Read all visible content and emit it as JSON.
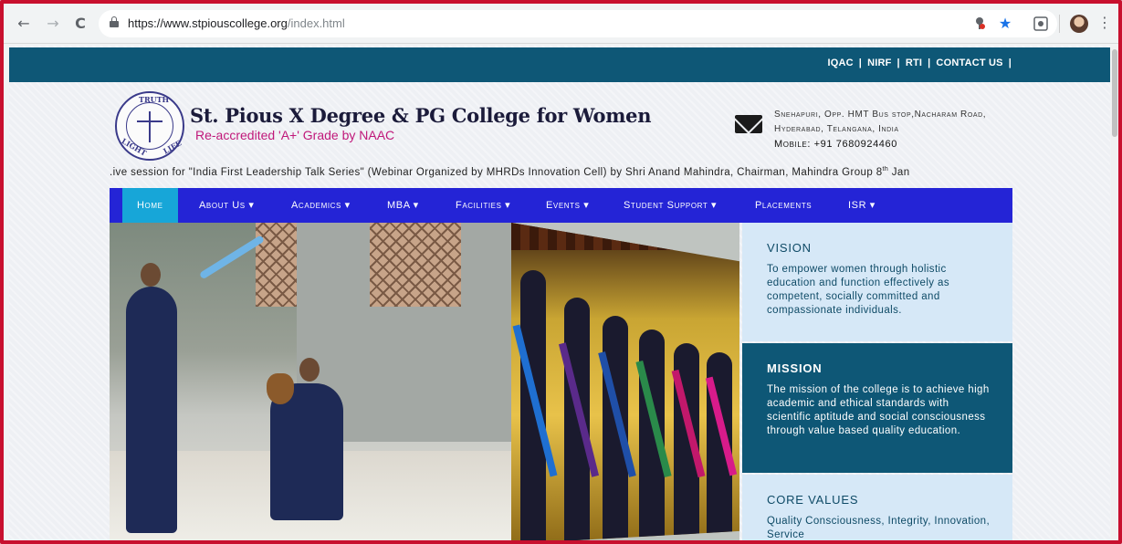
{
  "browser": {
    "url_domain": "https://www.stpiouscollege.org",
    "url_path": "/index.html",
    "back_icon": "←",
    "forward_icon": "→",
    "reload_icon": "C",
    "menu_icon": "⋮"
  },
  "top_links": [
    "IQAC",
    "NIRF",
    "RTI",
    "CONTACT US"
  ],
  "top_links_sep": "|",
  "header": {
    "college_name": "St. Pious X Degree & PG College for Women",
    "accreditation": "Re-accredited 'A+' Grade by NAAC",
    "seal_top": "TRUTH",
    "seal_left": "LIGHT",
    "seal_right": "LIFE",
    "address_line1": "Snehapuri, Opp. HMT Bus stop,Nacharam Road,",
    "address_line2": "Hyderabad, Telangana, India",
    "mobile": "Mobile: +91 7680924460"
  },
  "news_ticker": {
    "text": ".ive session for \"India First Leadership Talk Series\" (Webinar Organized by MHRDs Innovation Cell) by Shri Anand Mahindra, Chairman, Mahindra Group 8",
    "sup": "th",
    "tail": " Jan"
  },
  "nav": {
    "items": [
      {
        "label": "Home"
      },
      {
        "label": "About Us ▾"
      },
      {
        "label": "Academics ▾"
      },
      {
        "label": "MBA ▾"
      },
      {
        "label": "Facilities ▾"
      },
      {
        "label": "Events ▾"
      },
      {
        "label": "Student Support ▾"
      },
      {
        "label": "Placements"
      },
      {
        "label": "ISR ▾"
      }
    ]
  },
  "panels": {
    "vision_title": "VISION",
    "vision_text": "To empower women through holistic education and function effectively as competent, socially committed and compassionate individuals.",
    "mission_title": "MISSION",
    "mission_text": "The mission of the college is to achieve high academic and ethical standards with scientific aptitude and social consciousness through value based quality education.",
    "core_title": "CORE VALUES",
    "core_text": "Quality Consciousness, Integrity, Innovation, Service"
  },
  "colors": {
    "topbar": "#0e5776",
    "nav": "#2424d6",
    "nav_active": "#17a6d8",
    "accent_pink": "#c0187a",
    "panel_light": "#d6e8f7",
    "frame_border": "#c8102e"
  }
}
